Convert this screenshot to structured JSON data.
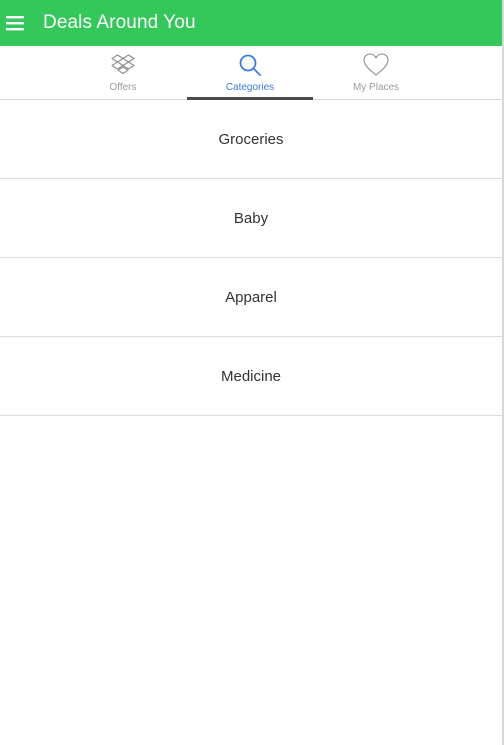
{
  "appbar": {
    "title": "Deals Around You",
    "background": "#34c85a",
    "menu_icon": "hamburger-menu-icon"
  },
  "tabs": [
    {
      "label": "Offers",
      "icon": "dropbox-icon",
      "active": false
    },
    {
      "label": "Categories",
      "icon": "search-icon",
      "active": true
    },
    {
      "label": "My Places",
      "icon": "heart-icon",
      "active": false
    }
  ],
  "colors": {
    "accent": "#3b7ddd",
    "tab_inactive": "#9a9a9a",
    "indicator": "#4a4a4a"
  },
  "categories": [
    {
      "label": "Groceries"
    },
    {
      "label": "Baby"
    },
    {
      "label": "Apparel"
    },
    {
      "label": "Medicine"
    }
  ]
}
